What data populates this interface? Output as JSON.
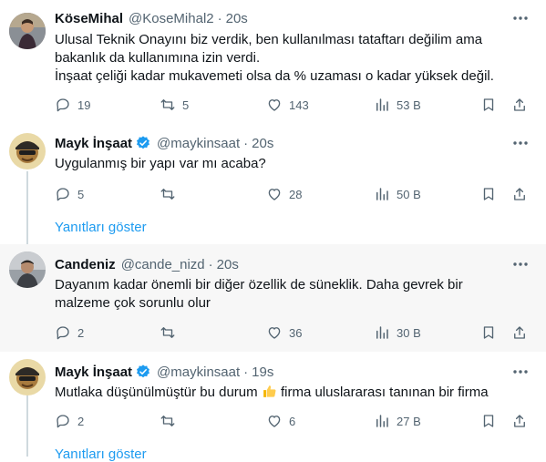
{
  "tweets": [
    {
      "name": "KöseMihal",
      "handle": "@KoseMihal2",
      "time": "20s",
      "lines": [
        "Ulusal Teknik Onayını biz verdik, ben kullanılması tataftarı değilim ama",
        "bakanlık da kullanımına izin verdi.",
        "İnşaat çeliği kadar mukavemeti olsa da  % uzaması o kadar yüksek değil."
      ],
      "replies": "19",
      "retweets": "5",
      "likes": "143",
      "views": "53 B"
    },
    {
      "name": "Mayk İnşaat",
      "handle": "@maykinsaat",
      "time": "20s",
      "verified": true,
      "lines": [
        "Uygulanmış bir yapı var mı acaba?"
      ],
      "replies": "5",
      "retweets": "",
      "likes": "28",
      "views": "50 B"
    },
    {
      "name": "Candeniz",
      "handle": "@cande_nizd",
      "time": "20s",
      "lines": [
        "Dayanım kadar önemli bir diğer özellik de süneklik. Daha gevrek bir",
        "malzeme çok sorunlu olur"
      ],
      "replies": "2",
      "retweets": "",
      "likes": "36",
      "views": "30 B"
    },
    {
      "name": "Mayk İnşaat",
      "handle": "@maykinsaat",
      "time": "19s",
      "verified": true,
      "line_before_emoji": "Mutlaka düşünülmüştür bu durum ",
      "line_after_emoji": " firma uluslararası tanınan bir firma",
      "replies": "2",
      "retweets": "",
      "likes": "6",
      "views": "27 B"
    }
  ],
  "show_replies_label": "Yanıtları göster",
  "show_replies_label_2": "Yanıtları göster",
  "colors": {
    "accent": "#1d9bf0",
    "secondary_text": "#536471",
    "highlight_bg": "#f7f7f7"
  }
}
